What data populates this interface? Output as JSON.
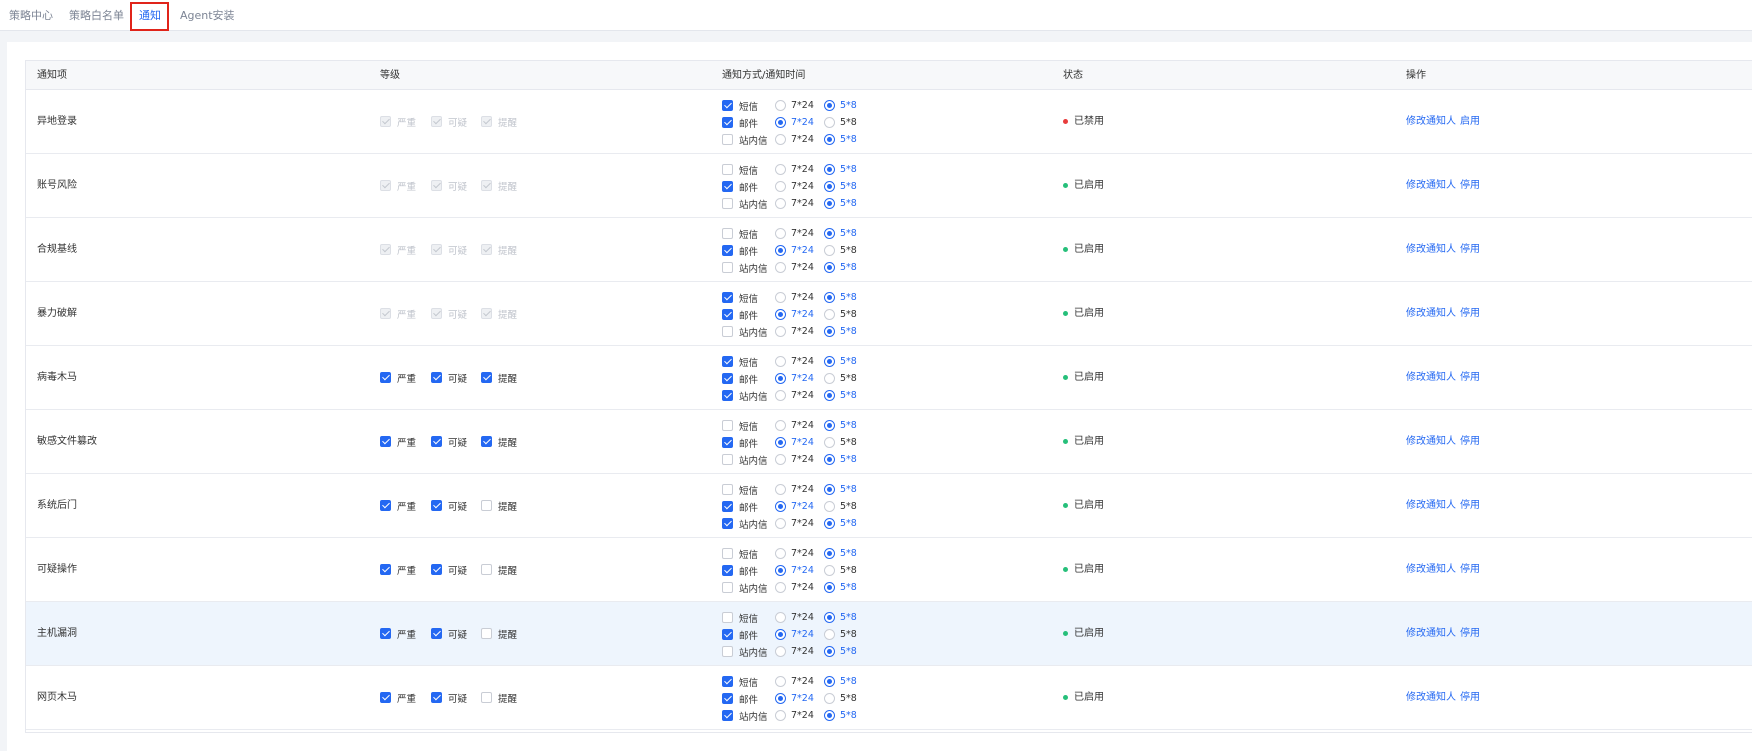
{
  "tabs": [
    {
      "label": "策略中心",
      "active": false
    },
    {
      "label": "策略白名单",
      "active": false
    },
    {
      "label": "通知",
      "active": true
    },
    {
      "label": "Agent安装",
      "active": false
    }
  ],
  "colors": {
    "accent": "#2468f2",
    "enabled_dot": "#26bf7a",
    "disabled_dot": "#e83b3b",
    "highlight_box": "#e0241a"
  },
  "table": {
    "headers": {
      "item": "通知项",
      "level": "等级",
      "method": "通知方式/通知时间",
      "status": "状态",
      "action": "操作"
    },
    "level_labels": [
      "严重",
      "可疑",
      "提醒"
    ],
    "channel_labels": [
      "短信",
      "邮件",
      "站内信"
    ],
    "time_labels": [
      "7*24",
      "5*8"
    ],
    "rows": [
      {
        "name": "异地登录",
        "levels_disabled": true,
        "levels": [
          true,
          true,
          true
        ],
        "channels": [
          {
            "on": true,
            "time": 1
          },
          {
            "on": true,
            "time": 0
          },
          {
            "on": false,
            "time": 1
          }
        ],
        "status": "已禁用",
        "enabled": false,
        "action_edit": "修改通知人",
        "action_toggle": "启用"
      },
      {
        "name": "账号风险",
        "levels_disabled": true,
        "levels": [
          true,
          true,
          true
        ],
        "channels": [
          {
            "on": false,
            "time": 1
          },
          {
            "on": true,
            "time": 1
          },
          {
            "on": false,
            "time": 1
          }
        ],
        "status": "已启用",
        "enabled": true,
        "action_edit": "修改通知人",
        "action_toggle": "停用"
      },
      {
        "name": "合规基线",
        "levels_disabled": true,
        "levels": [
          true,
          true,
          true
        ],
        "channels": [
          {
            "on": false,
            "time": 1
          },
          {
            "on": true,
            "time": 0
          },
          {
            "on": false,
            "time": 1
          }
        ],
        "status": "已启用",
        "enabled": true,
        "action_edit": "修改通知人",
        "action_toggle": "停用"
      },
      {
        "name": "暴力破解",
        "levels_disabled": true,
        "levels": [
          true,
          true,
          true
        ],
        "channels": [
          {
            "on": true,
            "time": 1
          },
          {
            "on": true,
            "time": 0
          },
          {
            "on": false,
            "time": 1
          }
        ],
        "status": "已启用",
        "enabled": true,
        "action_edit": "修改通知人",
        "action_toggle": "停用"
      },
      {
        "name": "病毒木马",
        "levels_disabled": false,
        "levels": [
          true,
          true,
          true
        ],
        "channels": [
          {
            "on": true,
            "time": 1
          },
          {
            "on": true,
            "time": 0
          },
          {
            "on": true,
            "time": 1
          }
        ],
        "status": "已启用",
        "enabled": true,
        "action_edit": "修改通知人",
        "action_toggle": "停用"
      },
      {
        "name": "敏感文件篡改",
        "levels_disabled": false,
        "levels": [
          true,
          true,
          true
        ],
        "channels": [
          {
            "on": false,
            "time": 1
          },
          {
            "on": true,
            "time": 0
          },
          {
            "on": false,
            "time": 1
          }
        ],
        "status": "已启用",
        "enabled": true,
        "action_edit": "修改通知人",
        "action_toggle": "停用"
      },
      {
        "name": "系统后门",
        "levels_disabled": false,
        "levels": [
          true,
          true,
          false
        ],
        "channels": [
          {
            "on": false,
            "time": 1
          },
          {
            "on": true,
            "time": 0
          },
          {
            "on": true,
            "time": 1
          }
        ],
        "status": "已启用",
        "enabled": true,
        "action_edit": "修改通知人",
        "action_toggle": "停用"
      },
      {
        "name": "可疑操作",
        "levels_disabled": false,
        "levels": [
          true,
          true,
          false
        ],
        "channels": [
          {
            "on": false,
            "time": 1
          },
          {
            "on": true,
            "time": 0
          },
          {
            "on": false,
            "time": 1
          }
        ],
        "status": "已启用",
        "enabled": true,
        "action_edit": "修改通知人",
        "action_toggle": "停用"
      },
      {
        "name": "主机漏洞",
        "levels_disabled": false,
        "levels": [
          true,
          true,
          false
        ],
        "channels": [
          {
            "on": false,
            "time": 1
          },
          {
            "on": true,
            "time": 0
          },
          {
            "on": false,
            "time": 1
          }
        ],
        "status": "已启用",
        "enabled": true,
        "highlight": true,
        "action_edit": "修改通知人",
        "action_toggle": "停用"
      },
      {
        "name": "网页木马",
        "levels_disabled": false,
        "levels": [
          true,
          true,
          false
        ],
        "channels": [
          {
            "on": true,
            "time": 1
          },
          {
            "on": true,
            "time": 0
          },
          {
            "on": true,
            "time": 1
          }
        ],
        "status": "已启用",
        "enabled": true,
        "action_edit": "修改通知人",
        "action_toggle": "停用"
      }
    ]
  }
}
